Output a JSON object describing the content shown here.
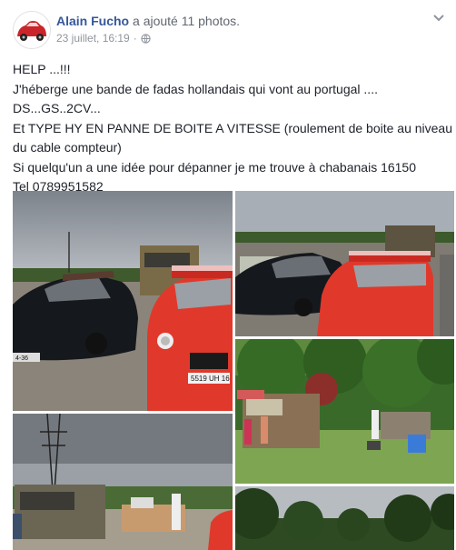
{
  "post": {
    "author": "Alain Fucho",
    "action": "a ajouté 11 photos.",
    "timestamp": "23 juillet, 16:19",
    "separator": "·",
    "privacy_icon": "globe-icon",
    "menu_icon": "chevron-down-icon"
  },
  "body": {
    "lines": [
      "HELP ...!!!",
      "J'héberge une bande de fadas hollandais qui vont au portugal ....",
      "DS...GS..2CV...",
      "Et TYPE HY EN PANNE DE BOITE A VITESSE (roulement de boite au niveau",
      "du cable compteur)",
      "Si quelqu'un a une idée pour dépanner je me trouve à chabanais 16150",
      "Tel 0789951582"
    ]
  },
  "photos": {
    "plate_text": "5519 UH 16",
    "side_plate_text": "4-36"
  },
  "colors": {
    "link": "#365899",
    "meta": "#90949c",
    "text": "#1d2129",
    "car_red": "#e0392b",
    "car_black": "#15181c"
  }
}
